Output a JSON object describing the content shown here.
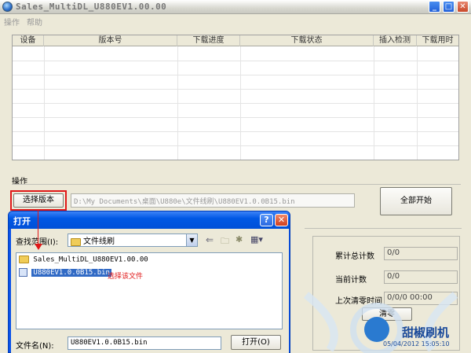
{
  "window": {
    "title": "Sales_MultiDL_U880EV1.00.00"
  },
  "menu": [
    "操作",
    "帮助"
  ],
  "table": {
    "columns": [
      "设备",
      "版本号",
      "下载进度",
      "下载状态",
      "插入检测",
      "下载用时"
    ]
  },
  "operation": {
    "group_label": "操作",
    "select_version_label": "选择版本",
    "path_value": "D:\\My Documents\\桌面\\U880e\\文件线刷\\U880EV1.0.0B15.bin",
    "start_all_label": "全部开始"
  },
  "counters": {
    "total_label": "累计总计数",
    "total_value": "0/0",
    "current_label": "当前计数",
    "current_value": "0/0",
    "last_reset_label": "上次清零时间",
    "last_reset_value": "0/0/0 00:00",
    "reset_label": "清零"
  },
  "dialog": {
    "title": "打开",
    "lookin_label": "查找范围(I):",
    "lookin_value": "文件线刷",
    "items": [
      {
        "name": "Sales_MultiDL_U880EV1.00.00",
        "type": "folder"
      },
      {
        "name": "U880EV1.0.0B15.bin",
        "type": "file"
      }
    ],
    "annotation": "选择该文件",
    "filename_label": "文件名(N):",
    "filename_value": "U880EV1.0.0B15.bin",
    "open_label": "打开(O)"
  },
  "watermark": {
    "text": "甜椒刷机",
    "date": "05/04/2012 15:05:10"
  },
  "colors": {
    "highlight": "#e01818",
    "dialog_blue": "#0a52e8",
    "selection": "#316ac5"
  }
}
